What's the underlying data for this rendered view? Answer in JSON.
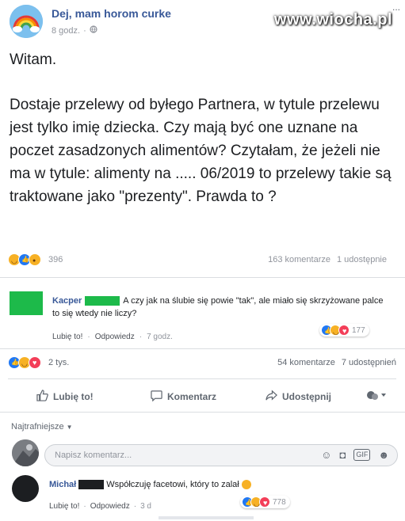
{
  "header": {
    "group_name": "Dej, mam horom curke",
    "time": "8 godz.",
    "privacy_icon": "globe-icon",
    "menu": "...",
    "watermark": "www.wiocha.pl"
  },
  "post": {
    "greeting": "Witam.",
    "body": "Dostaje przelewy od byłego Partnera, w tytule przelewu jest tylko imię dziecka. Czy mają być one uznane na poczet zasadzonych alimentów? Czytałam, że jeżeli nie ma w tytule: alimenty na ..... 06/2019 to przelewy takie są traktowane jako \"prezenty\". Prawda to ?",
    "reactions_count": "396",
    "comments_count": "163 komentarze",
    "shares_count": "1 udostępnie"
  },
  "embedded_comment": {
    "author": "Kacper",
    "text": "A czy jak na ślubie się powie \"tak\", ale miało się skrzyżowane palce to się wtedy nie liczy?",
    "like_label": "Lubię to!",
    "reply_label": "Odpowiedz",
    "time": "7 godz.",
    "reactions_count": "177"
  },
  "stats": {
    "reactions": "2 tys.",
    "comments": "54 komentarze",
    "shares": "7 udostępnień"
  },
  "actions": {
    "like": "Lubię to!",
    "comment": "Komentarz",
    "share": "Udostępnij"
  },
  "comments": {
    "sort_label": "Najtrafniejsze",
    "input_placeholder": "Napisz komentarz...",
    "items": [
      {
        "author": "Michał",
        "text": "Współczuję facetowi, który to zalał",
        "like_label": "Lubię to!",
        "reply_label": "Odpowiedz",
        "time": "3 d",
        "reactions_count": "778"
      }
    ]
  },
  "colors": {
    "link": "#385898",
    "meta": "#90949c",
    "like_blue": "#2078f4",
    "censor_green": "#1dba4a"
  }
}
